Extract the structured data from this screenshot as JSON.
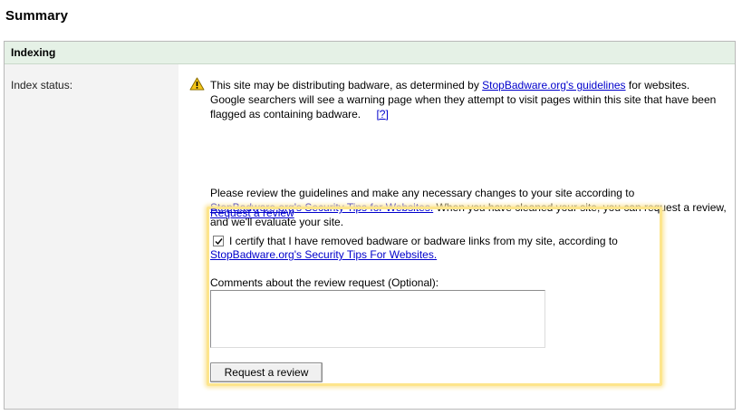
{
  "summary": {
    "title": "Summary"
  },
  "indexing": {
    "header": "Indexing",
    "index_status_label": "Index status:",
    "warning_icon": "warning-triangle-icon",
    "status_text_1": "This site may be distributing badware, as determined by",
    "guidelines_link": "StopBadware.org's guidelines",
    "status_text_2": "for websites. Google searchers will see a warning page when they attempt to visit pages within this site that have been flagged as containing badware.",
    "help_link": "[?]",
    "review_text_1": "Please review the guidelines and make any necessary changes to your site according to",
    "security_tips_link": "StopBadware.org's Security Tips for Websites.",
    "review_text_2": "When you have cleaned your site, you can request a review, and we'll evaluate your site.",
    "request_review_link": "Request a review"
  },
  "review_form": {
    "certify_checked": true,
    "certify_text": "I certify that I have removed badware or badware links from my site, according to",
    "certify_link": "StopBadware.org's Security Tips For Websites.",
    "comments_label": "Comments about the review request (Optional):",
    "comments_value": "",
    "submit_label": "Request a review"
  },
  "colors": {
    "header_bg": "#e5f1e6",
    "label_column_bg": "#f3f3f3",
    "highlight_border": "#fde58c",
    "link": "#0000cc",
    "warning_fill": "#f5c518"
  }
}
